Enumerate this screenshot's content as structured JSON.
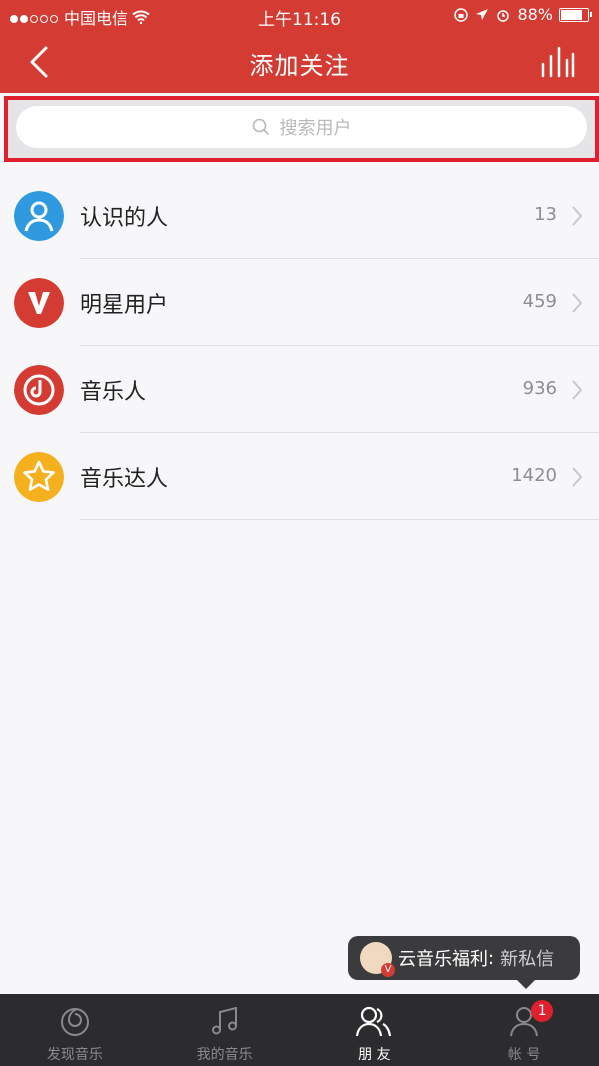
{
  "status": {
    "carrier": "中国电信",
    "time": "上午11:16",
    "battery": "88%",
    "battery_level": 0.88
  },
  "nav": {
    "title": "添加关注"
  },
  "search": {
    "placeholder": "搜索用户"
  },
  "list": [
    {
      "label": "认识的人",
      "count": "13",
      "color": "#2f9ae0",
      "icon": "person-icon"
    },
    {
      "label": "明星用户",
      "count": "459",
      "color": "#d43c33",
      "icon": "v-badge-icon"
    },
    {
      "label": "音乐人",
      "count": "936",
      "color": "#d43c33",
      "icon": "music-note-icon"
    },
    {
      "label": "音乐达人",
      "count": "1420",
      "color": "#f5b01e",
      "icon": "star-icon"
    }
  ],
  "toast": {
    "name": "云音乐福利",
    "sep": ":",
    "text": "新私信"
  },
  "tabs": [
    {
      "label": "发现音乐",
      "icon": "discover-icon"
    },
    {
      "label": "我的音乐",
      "icon": "music-icon"
    },
    {
      "label": "朋 友",
      "icon": "friends-icon",
      "active": true
    },
    {
      "label": "帐 号",
      "icon": "account-icon",
      "badge": "1"
    }
  ],
  "colors": {
    "accent": "#d43c33",
    "highlight": "#e0202f"
  }
}
